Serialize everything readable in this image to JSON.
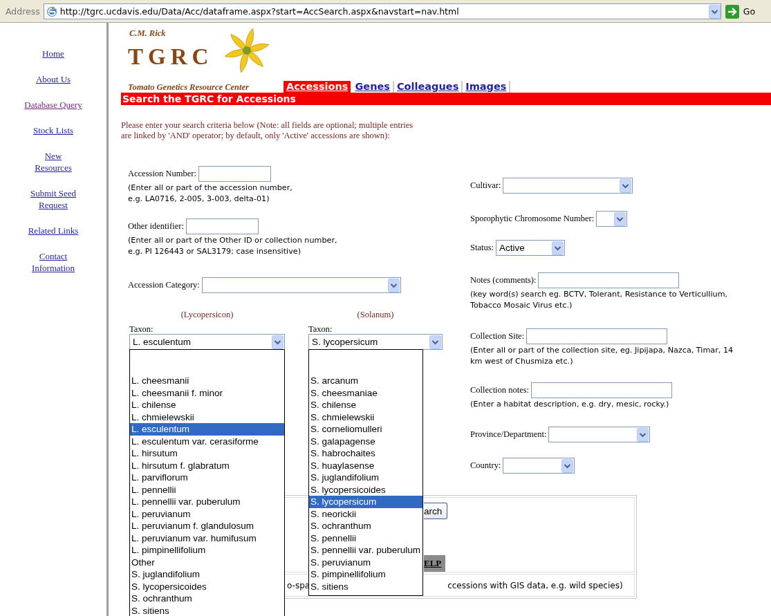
{
  "address_bar": {
    "label": "Address",
    "url": "http://tgrc.ucdavis.edu/Data/Acc/dataframe.aspx?start=AccSearch.aspx&navstart=nav.html",
    "go": "Go"
  },
  "nav": [
    {
      "label": "Home",
      "visited": false
    },
    {
      "label": "About Us",
      "visited": false
    },
    {
      "label": "Database Query",
      "visited": true
    },
    {
      "label": "Stock Lists",
      "visited": false
    },
    {
      "label": "New\nResources",
      "visited": false
    },
    {
      "label": "Submit Seed\nRequest",
      "visited": false
    },
    {
      "label": "Related Links",
      "visited": false
    },
    {
      "label": "Contact\nInformation",
      "visited": false
    }
  ],
  "logo": {
    "top": "C.M. Rick",
    "name": "TGRC",
    "tagline": "Tomato Genetics Resource Center"
  },
  "tabs": [
    {
      "label": "Accessions",
      "selected": true
    },
    {
      "label": "Genes",
      "selected": false
    },
    {
      "label": "Colleagues",
      "selected": false
    },
    {
      "label": "Images",
      "selected": false
    }
  ],
  "banner": "Search the TGRC for Accessions",
  "intro": "Please enter your search criteria below (Note: all fields are optional; multiple entries\nare linked by 'AND' operator; by default, only 'Active' accessions are shown):",
  "left_fields": [
    {
      "kind": "text",
      "label": "Accession Number:",
      "hint": "(Enter all or part of the accession number,\ne.g. LA0716, 2-005, 3-003, delta-01)"
    },
    {
      "kind": "text",
      "label": "Other identifier:",
      "hint": "(Enter all or part of the Other ID or collection number,\ne.g. PI 126443 or SAL3179; case insensitive)"
    },
    {
      "kind": "select",
      "label": "Accession Category:"
    }
  ],
  "taxon_pickers": [
    {
      "heading": "(Lycopersicon)",
      "label": "Taxon:",
      "value": "L. esculentum",
      "expanded": true,
      "options": [
        {
          "label": "L. cheesmanii",
          "selected": false
        },
        {
          "label": "L. cheesmanii f. minor",
          "selected": false
        },
        {
          "label": "L. chilense",
          "selected": false
        },
        {
          "label": "L. chmielewskii",
          "selected": false
        },
        {
          "label": "L. esculentum",
          "selected": true
        },
        {
          "label": "L. esculentum var. cerasiforme",
          "selected": false
        },
        {
          "label": "L. hirsutum",
          "selected": false
        },
        {
          "label": "L. hirsutum f. glabratum",
          "selected": false
        },
        {
          "label": "L. parviflorum",
          "selected": false
        },
        {
          "label": "L. pennellii",
          "selected": false
        },
        {
          "label": "L. pennellii var. puberulum",
          "selected": false
        },
        {
          "label": "L. peruvianum",
          "selected": false
        },
        {
          "label": "L. peruvianum f. glandulosum",
          "selected": false
        },
        {
          "label": "L. peruvianum var. humifusum",
          "selected": false
        },
        {
          "label": "L. pimpinellifolium",
          "selected": false
        },
        {
          "label": "Other",
          "selected": false
        },
        {
          "label": "S. juglandifolium",
          "selected": false
        },
        {
          "label": "S. lycopersicoides",
          "selected": false
        },
        {
          "label": "S. ochranthum",
          "selected": false
        },
        {
          "label": "S. sitiens",
          "selected": false
        }
      ]
    },
    {
      "heading": "(Solanum)",
      "label": "Taxon:",
      "value": "S. lycopersicum",
      "expanded": true,
      "options": [
        {
          "label": "S. arcanum",
          "selected": false
        },
        {
          "label": "S. cheesmaniae",
          "selected": false
        },
        {
          "label": "S. chilense",
          "selected": false
        },
        {
          "label": "S. chmielewskii",
          "selected": false
        },
        {
          "label": "S. corneliomulleri",
          "selected": false
        },
        {
          "label": "S. galapagense",
          "selected": false
        },
        {
          "label": "S. habrochaites",
          "selected": false
        },
        {
          "label": "S. huaylasense",
          "selected": false
        },
        {
          "label": "S. juglandifolium",
          "selected": false
        },
        {
          "label": "S. lycopersicoides",
          "selected": false
        },
        {
          "label": "S. lycopersicum",
          "selected": true
        },
        {
          "label": "S. neorickii",
          "selected": false
        },
        {
          "label": "S. ochranthum",
          "selected": false
        },
        {
          "label": "S. pennellii",
          "selected": false
        },
        {
          "label": "S. pennellii var. puberulum",
          "selected": false
        },
        {
          "label": "S. peruvianum",
          "selected": false
        },
        {
          "label": "S. pimpinellifolium",
          "selected": false
        },
        {
          "label": "S. sitiens",
          "selected": false
        }
      ]
    }
  ],
  "right_fields": [
    {
      "kind": "select",
      "label": "Cultivar:"
    },
    {
      "kind": "select",
      "label": "Sporophytic Chromosome Number:"
    },
    {
      "kind": "select",
      "label": "Status:",
      "value": "Active"
    },
    {
      "kind": "text",
      "label": "Notes (comments):",
      "hint": "(key word(s) search eg. BCTV, Tolerant, Resistance to Verticullium,\nTobacco Mosaic Virus etc.)"
    },
    {
      "kind": "text",
      "label": "Collection Site:",
      "hint": "(Enter all or part of the collection site, eg. Jipijapa, Nazca, Timar, 14\nkm west of Chusmiza etc.)"
    },
    {
      "kind": "text",
      "label": "Collection notes:",
      "hint": "(Enter a habitat description, e.g. dry, mesic, rocky.)"
    },
    {
      "kind": "select",
      "label": "Province/Department:"
    },
    {
      "kind": "select",
      "label": "Country:"
    }
  ],
  "search_panel": {
    "button": "arch",
    "help": "ELP",
    "note_start": "o-spa",
    "note_end": "ccessions with GIS data, e.g. wild species)"
  }
}
